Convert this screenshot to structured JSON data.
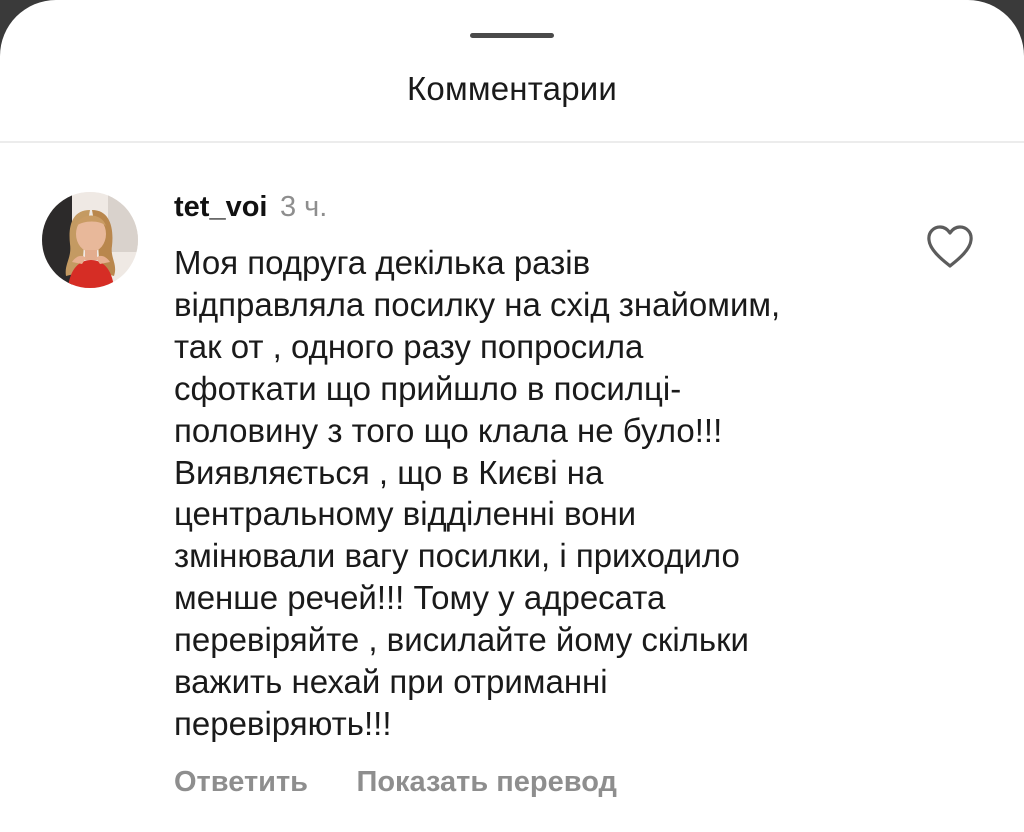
{
  "sheet": {
    "title": "Комментарии"
  },
  "comment": {
    "username": "tet_voi",
    "time": "3 ч.",
    "text": "Моя подруга декілька разів\nвідправляла посилку на схід знайомим,\nтак от , одного разу попросила\nсфоткати що прийшло в посилці-\nполовину з того що клала не було!!!\nВиявляється , що в Києві на\nцентральному відділенні вони\nзмінювали вагу посилки, і приходило\nменше речей!!! Тому у адресата\nперевіряйте , висилайте йому скільки\nважить нехай при отриманні\nперевіряють!!!",
    "reply_label": "Ответить",
    "translate_label": "Показать перевод",
    "like_icon": "heart-outline-icon",
    "avatar": "user-avatar"
  },
  "colors": {
    "background": "#ffffff",
    "text": "#111111",
    "secondary_text": "#8e8e8e",
    "divider": "#ececec",
    "handle": "#4a4a4a"
  }
}
